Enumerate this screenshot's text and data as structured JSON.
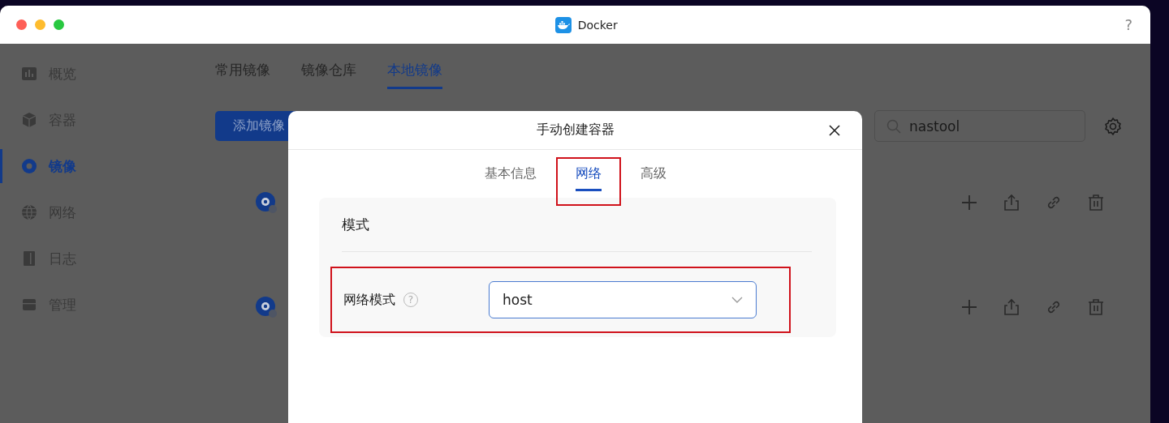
{
  "window": {
    "title": "Docker",
    "help": "?"
  },
  "sidebar": {
    "items": [
      {
        "label": "概览",
        "kind": "chart",
        "selected": false
      },
      {
        "label": "容器",
        "kind": "cube",
        "selected": false
      },
      {
        "label": "镜像",
        "kind": "disc",
        "selected": true
      },
      {
        "label": "网络",
        "kind": "globe",
        "selected": false
      },
      {
        "label": "日志",
        "kind": "book",
        "selected": false
      },
      {
        "label": "管理",
        "kind": "drive",
        "selected": false
      }
    ]
  },
  "tabs": [
    {
      "label": "常用镜像",
      "selected": false
    },
    {
      "label": "镜像仓库",
      "selected": false
    },
    {
      "label": "本地镜像",
      "selected": true
    }
  ],
  "add_button": "添加镜像",
  "search": {
    "value": "nastool"
  },
  "image_rows": [
    {
      "kind": "image"
    },
    {
      "kind": "image"
    }
  ],
  "dialog": {
    "title": "手动创建容器",
    "tabs": [
      {
        "label": "基本信息",
        "selected": false,
        "highlighted": false
      },
      {
        "label": "网络",
        "selected": true,
        "highlighted": true
      },
      {
        "label": "高级",
        "selected": false,
        "highlighted": false
      }
    ],
    "section": {
      "title": "模式",
      "fields": [
        {
          "label": "网络模式",
          "help": "?",
          "value": "host",
          "highlighted": true
        }
      ]
    }
  }
}
